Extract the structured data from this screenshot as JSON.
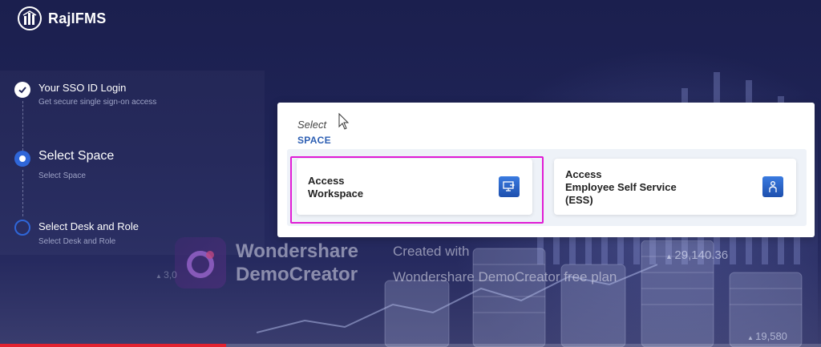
{
  "brand": {
    "name": "RajIFMS",
    "logo_icon": "rajifms-logo-icon"
  },
  "steps": [
    {
      "title": "Your SSO ID Login",
      "subtitle": "Get secure single sign-on access",
      "status": "done"
    },
    {
      "title": "Select Space",
      "subtitle": "Select Space",
      "status": "active"
    },
    {
      "title": "Select Desk and Role",
      "subtitle": "Select Desk and Role",
      "status": "pending"
    }
  ],
  "card": {
    "select_label": "Select",
    "space_label": "SPACE",
    "options": [
      {
        "line1": "Access",
        "line2": "Workspace",
        "icon": "monitor-arrow-icon"
      },
      {
        "line1": "Access",
        "line2": "Employee Self Service",
        "line3": "(ESS)",
        "icon": "user-hand-icon"
      }
    ]
  },
  "watermark": {
    "brand_line1": "Wondershare",
    "brand_line2": "DemoCreator",
    "note_line1": "Created with",
    "note_line2": "Wondershare DemoCreator free plan"
  },
  "tickers": {
    "value1": "29,140.36",
    "value2": "19,580",
    "value3": "3,0"
  },
  "colors": {
    "accent": "#2f66d8",
    "highlight": "#e01cd5",
    "progress": "#e3232f",
    "space_label": "#2d5fb3"
  },
  "video_progress": 0.275
}
